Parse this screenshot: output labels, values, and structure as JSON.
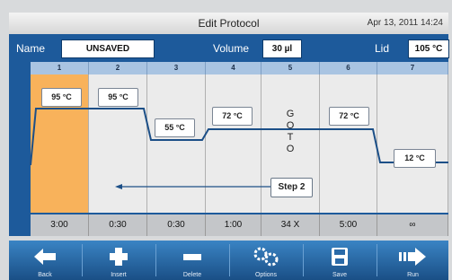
{
  "window": {
    "title": "Edit Protocol",
    "datetime": "Apr 13, 2011 14:24"
  },
  "fields": {
    "name_label": "Name",
    "name_value": "UNSAVED",
    "volume_label": "Volume",
    "volume_value": "30 µl",
    "lid_label": "Lid",
    "lid_value": "105 °C"
  },
  "steps": [
    {
      "num": "1",
      "time": "3:00",
      "temp": "95 °C"
    },
    {
      "num": "2",
      "time": "0:30",
      "temp": "95 °C"
    },
    {
      "num": "3",
      "time": "0:30",
      "temp": "55 °C"
    },
    {
      "num": "4",
      "time": "1:00",
      "temp": "72 °C"
    },
    {
      "num": "5",
      "time": "34 X",
      "goto": [
        "G",
        "O",
        "T",
        "O"
      ],
      "target": "Step 2"
    },
    {
      "num": "6",
      "time": "5:00",
      "temp": "72 °C"
    },
    {
      "num": "7",
      "time": "∞",
      "temp": "12 °C"
    }
  ],
  "toolbar": {
    "back": "Back",
    "insert": "Insert",
    "delete": "Delete",
    "options": "Options",
    "save": "Save",
    "run": "Run"
  },
  "colors": {
    "header_blue": "#1d5a9b",
    "active_step": "#f8b25b",
    "profile_line": "#1c4f87"
  }
}
